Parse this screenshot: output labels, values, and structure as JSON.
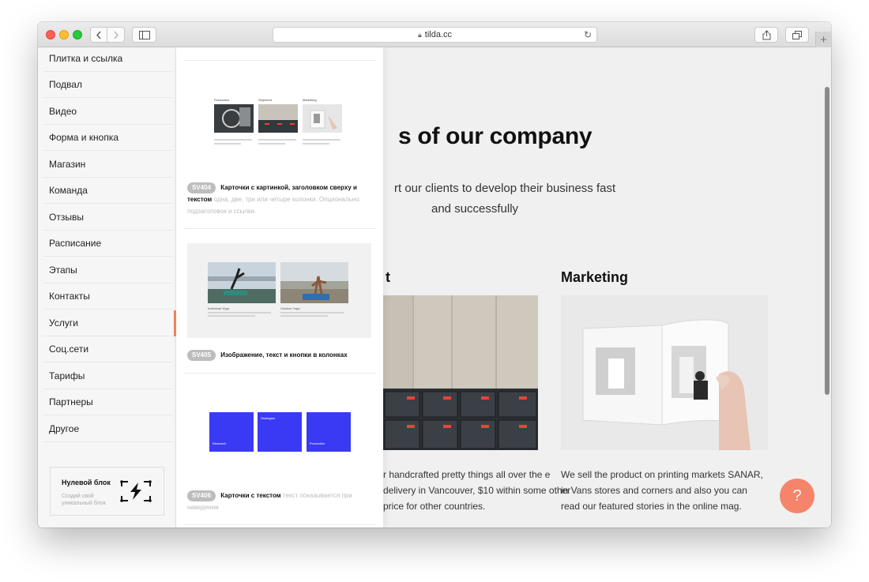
{
  "browser": {
    "url": "tilda.cc",
    "lock_icon": "lock-icon",
    "new_tab": "+"
  },
  "categories": [
    {
      "label": "Плитка и ссылка"
    },
    {
      "label": "Подвал"
    },
    {
      "label": "Видео"
    },
    {
      "label": "Форма и кнопка"
    },
    {
      "label": "Магазин"
    },
    {
      "label": "Команда"
    },
    {
      "label": "Отзывы"
    },
    {
      "label": "Расписание"
    },
    {
      "label": "Этапы"
    },
    {
      "label": "Контакты"
    },
    {
      "label": "Услуги",
      "active": true
    },
    {
      "label": "Соц.сети"
    },
    {
      "label": "Тарифы"
    },
    {
      "label": "Партнеры"
    },
    {
      "label": "Другое"
    }
  ],
  "zero_block": {
    "title": "Нулевой блок",
    "description": "Создай свой уникальный блок"
  },
  "blocks": [
    {
      "code": "SV404",
      "name": "Карточки с картинкой, заголовком сверху и текстом",
      "description": "одна, две, три или четыре колонки. Опционально: подзаголовок и ссылки.",
      "preview_captions": [
        "Production",
        "Shipment",
        "Marketing"
      ]
    },
    {
      "code": "SV405",
      "name": "Изображение, текст и кнопки в колонках",
      "preview_captions": [
        "Individual Yoga",
        "Outdoor Yoga"
      ]
    },
    {
      "code": "SV406",
      "name": "Карточки с текстом",
      "description": "текст показывается при наведении",
      "preview_captions": [
        "Research",
        "Strategies",
        "Production"
      ]
    }
  ],
  "site": {
    "heading": "s of our company",
    "subtitle_line1": "rt our clients to develop their business fast",
    "subtitle_line2": "and successfully",
    "col1_title": "t",
    "col1_text": "r handcrafted pretty things all over the e delivery in Vancouver, $10 within some other price for other countries.",
    "col2_title": "Marketing",
    "col2_text": "We sell the product on printing markets SANAR, in Vans stores and corners and also you can read our featured stories in the online mag.",
    "help": "?"
  },
  "colors": {
    "accent": "#f4845f",
    "zero_block_blue": "#3a3af5",
    "help_button": "#f5846b"
  }
}
